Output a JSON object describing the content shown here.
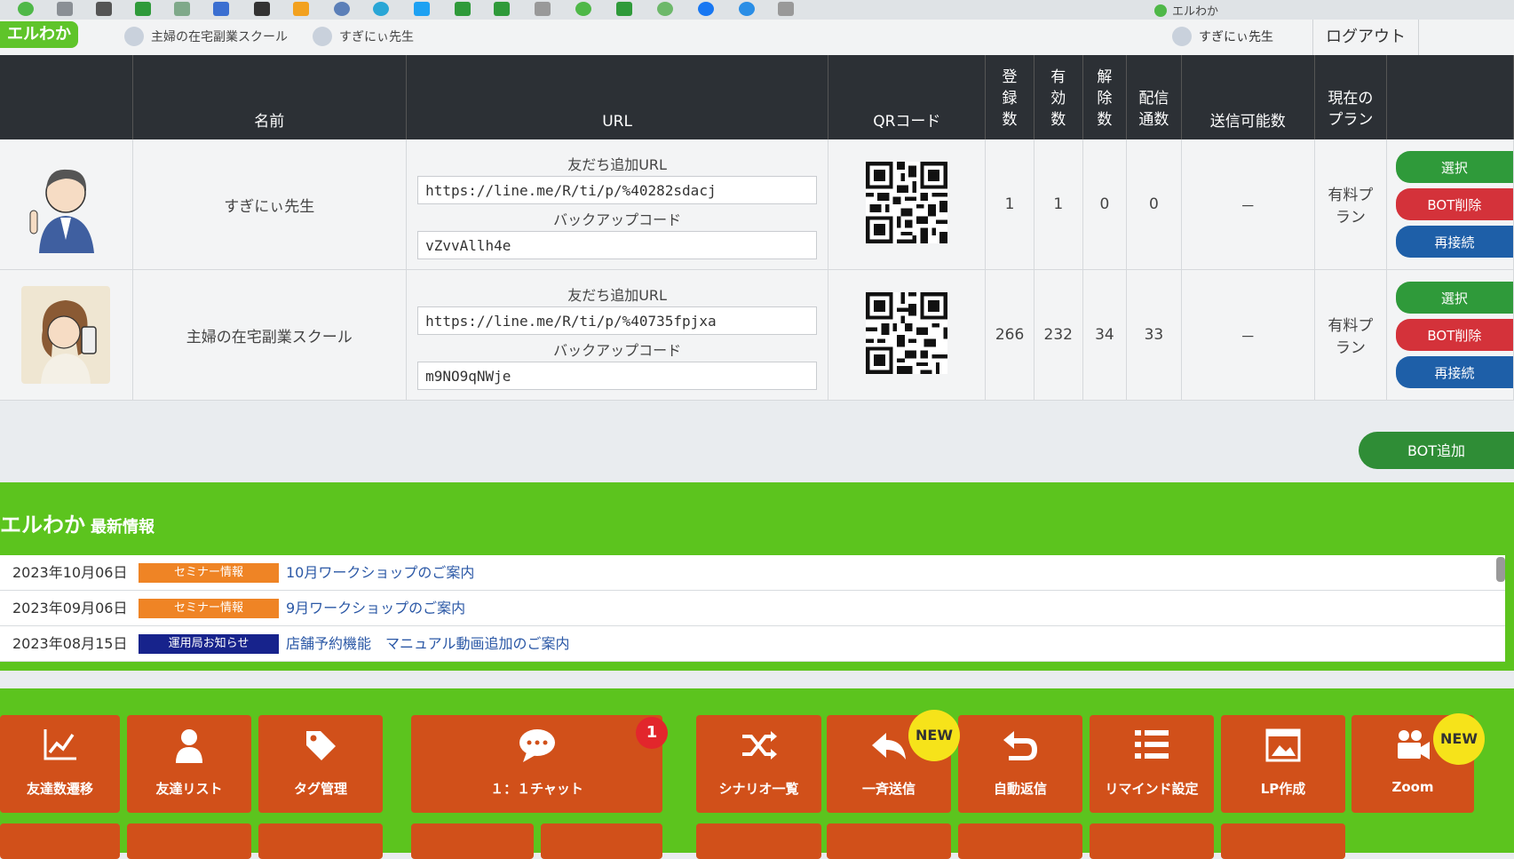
{
  "bookmark_bar": {
    "app_name": "エルわか"
  },
  "header": {
    "logo": "エルわか",
    "accounts": [
      "主婦の在宅副業スクール",
      "すぎにぃ先生"
    ],
    "current_user": "すぎにぃ先生",
    "logout_label": "ログアウト"
  },
  "table": {
    "headers": {
      "name": "名前",
      "url": "URL",
      "qr": "QRコード",
      "registered": "登\n録\n数",
      "active": "有\n効\n数",
      "removed": "解\n除\n数",
      "delivered": "配信\n通数",
      "sendable": "送信可能数",
      "plan": "現在の\nプラン"
    },
    "rows": [
      {
        "name": "すぎにぃ先生",
        "friend_url_label": "友だち追加URL",
        "friend_url": "https://line.me/R/ti/p/%40282sdacj",
        "backup_label": "バックアップコード",
        "backup_code": "vZvvAllh4e",
        "registered": "1",
        "active": "1",
        "removed": "0",
        "delivered": "0",
        "sendable": "－",
        "plan": "有料プ\nラン",
        "select_label": "選択",
        "delete_label": "BOT削除",
        "reconnect_label": "再接続"
      },
      {
        "name": "主婦の在宅副業スクール",
        "friend_url_label": "友だち追加URL",
        "friend_url": "https://line.me/R/ti/p/%40735fpjxa",
        "backup_label": "バックアップコード",
        "backup_code": "m9NO9qNWje",
        "registered": "266",
        "active": "232",
        "removed": "34",
        "delivered": "33",
        "sendable": "－",
        "plan": "有料プ\nラン",
        "select_label": "選択",
        "delete_label": "BOT削除",
        "reconnect_label": "再接続"
      }
    ]
  },
  "add_bot_label": "BOT追加",
  "news": {
    "title": "エルわか",
    "subtitle": "最新情報",
    "items": [
      {
        "date": "2023年10月06日",
        "category": "セミナー情報",
        "color": "#ef8425",
        "title": "10月ワークショップのご案内"
      },
      {
        "date": "2023年09月06日",
        "category": "セミナー情報",
        "color": "#ef8425",
        "title": "9月ワークショップのご案内"
      },
      {
        "date": "2023年08月15日",
        "category": "運用局お知らせ",
        "color": "#17238c",
        "title": "店舗予約機能　マニュアル動画追加のご案内"
      }
    ]
  },
  "menu": [
    {
      "label": "友達数遷移",
      "icon": "line-chart-icon"
    },
    {
      "label": "友達リスト",
      "icon": "person-icon"
    },
    {
      "label": "タグ管理",
      "icon": "tag-icon"
    },
    {
      "label": "１：１チャット",
      "icon": "chat-bubble-icon",
      "badge": "1"
    },
    {
      "label": "シナリオ一覧",
      "icon": "shuffle-icon"
    },
    {
      "label": "一斉送信",
      "icon": "reply-all-icon",
      "badge": "NEW"
    },
    {
      "label": "自動返信",
      "icon": "undo-icon"
    },
    {
      "label": "リマインド設定",
      "icon": "list-icon"
    },
    {
      "label": "LP作成",
      "icon": "lp-page-icon"
    },
    {
      "label": "Zoom",
      "icon": "video-camera-icon",
      "badge": "NEW"
    }
  ]
}
